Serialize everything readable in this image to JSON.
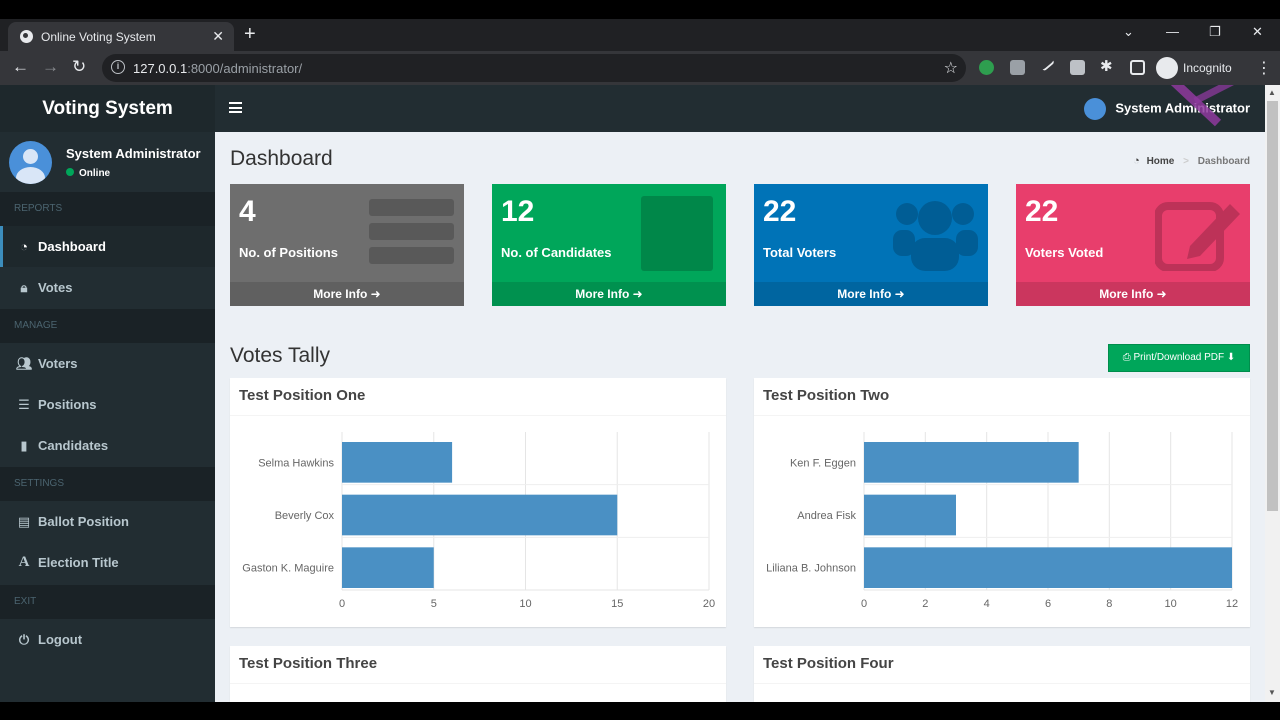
{
  "browser": {
    "tab_title": "Online Voting System",
    "url_host": "127.0.0.1",
    "url_rest": ":8000/administrator/",
    "profile_label": "Incognito"
  },
  "app": {
    "brand": "Voting System",
    "user_name": "System Administrator",
    "user_status": "Online",
    "nav_user": "System Administrator"
  },
  "sidebar": {
    "reports_header": "REPORTS",
    "dashboard": "Dashboard",
    "votes": "Votes",
    "manage_header": "MANAGE",
    "voters": "Voters",
    "positions": "Positions",
    "candidates": "Candidates",
    "settings_header": "SETTINGS",
    "ballot_position": "Ballot Position",
    "election_title": "Election Title",
    "exit_header": "EXIT",
    "logout": "Logout"
  },
  "header": {
    "title": "Dashboard",
    "breadcrumb_home": "Home",
    "breadcrumb_current": "Dashboard"
  },
  "stats": [
    {
      "number": "4",
      "label": "No. of Positions",
      "more": "More Info",
      "color": "#6e6e6e"
    },
    {
      "number": "12",
      "label": "No. of Candidates",
      "more": "More Info",
      "color": "#00a65a"
    },
    {
      "number": "22",
      "label": "Total Voters",
      "more": "More Info",
      "color": "#0073b7"
    },
    {
      "number": "22",
      "label": "Voters Voted",
      "more": "More Info",
      "color": "#e83e6c"
    }
  ],
  "tally": {
    "title": "Votes Tally",
    "pdf_button": "Print/Download PDF"
  },
  "boxes": {
    "one": "Test Position One",
    "two": "Test Position Two",
    "three": "Test Position Three",
    "four": "Test Position Four"
  },
  "chart_data": [
    {
      "type": "bar",
      "orientation": "horizontal",
      "title": "Test Position One",
      "categories": [
        "Selma Hawkins",
        "Beverly Cox",
        "Gaston K. Maguire"
      ],
      "values": [
        6,
        15,
        5
      ],
      "xlim": [
        0,
        20
      ],
      "ticks": [
        0,
        5,
        10,
        15,
        20
      ],
      "bar_color": "#4a90c4",
      "grid": true
    },
    {
      "type": "bar",
      "orientation": "horizontal",
      "title": "Test Position Two",
      "categories": [
        "Ken F. Eggen",
        "Andrea Fisk",
        "Liliana B. Johnson"
      ],
      "values": [
        7,
        3,
        12
      ],
      "xlim": [
        0,
        12
      ],
      "ticks": [
        0,
        2,
        4,
        6,
        8,
        10,
        12
      ],
      "bar_color": "#4a90c4",
      "grid": true
    }
  ]
}
